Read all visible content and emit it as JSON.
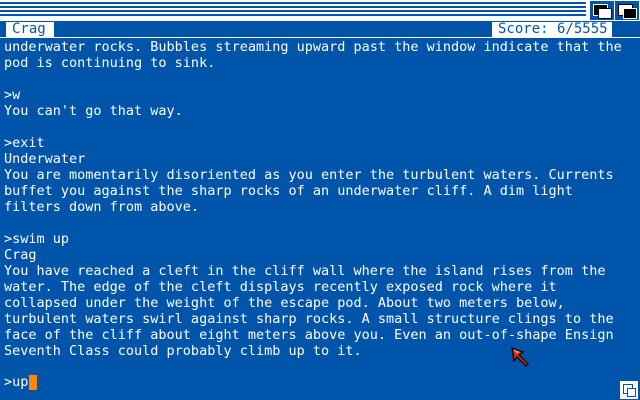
{
  "status": {
    "location": "Crag",
    "score": "Score: 6/5555"
  },
  "transcript": [
    "underwater rocks. Bubbles streaming upward past the window indicate that the",
    "pod is continuing to sink.",
    "",
    ">w",
    "You can't go that way.",
    "",
    ">exit",
    "Underwater",
    "You are momentarily disoriented as you enter the turbulent waters. Currents",
    "buffet you against the sharp rocks of an underwater cliff. A dim light",
    "filters down from above.",
    "",
    ">swim up",
    "Crag",
    "You have reached a cleft in the cliff wall where the island rises from the",
    "water. The edge of the cleft displays recently exposed rock where it",
    "collapsed under the weight of the escape pod. About two meters below,",
    "turbulent waters swirl against sharp rocks. A small structure clings to the",
    "face of the cliff about eight meters above you. Even an out-of-shape Ensign",
    "Seventh Class could probably climb up to it."
  ],
  "input": {
    "prompt": ">",
    "text": "up"
  },
  "icons": {
    "pointer": "mouse-pointer-icon",
    "depth_back": "depth-back-icon",
    "depth_front": "depth-front-icon",
    "resize": "resize-icon"
  },
  "colors": {
    "background": "#0055aa",
    "text": "#ffffff",
    "cursor": "#ff8800",
    "pointer": "#dd2200"
  }
}
